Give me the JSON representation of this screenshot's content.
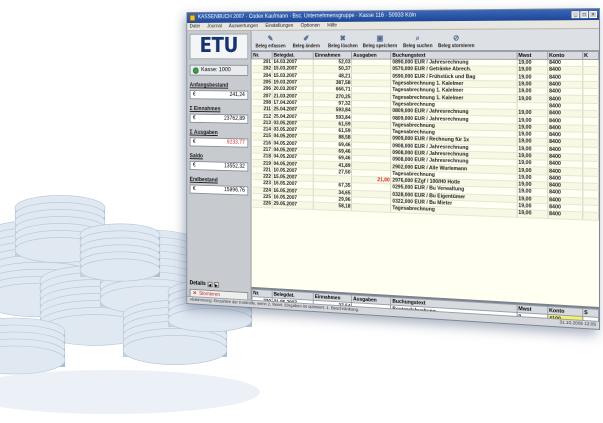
{
  "window": {
    "title": "KASSENBUCH 2007 · Codex Kaufmann · Bsc. Unternehmensgruppe · Kasse 116 · 50933 Köln",
    "menu": [
      "Datei",
      "Journal",
      "Auswertungen",
      "Einstellungen",
      "Optionen",
      "Hilfe"
    ]
  },
  "logo": "ETU",
  "sidebar": {
    "kasse": "Kasse: 1000",
    "anfangsbestand_label": "Anfangsbestand",
    "anfangsbestand_cur": "€",
    "anfangsbestand_value": "241,24",
    "einnahmen_label": "Σ Einnahmen",
    "einnahmen_cur": "€",
    "einnahmen_value": "23762,89",
    "ausgaben_label": "Σ Ausgaben",
    "ausgaben_cur": "€",
    "ausgaben_value": "9233,77",
    "saldo_label": "Saldo",
    "saldo_cur": "€",
    "saldo_value": "13552,32",
    "endbestand_label": "Endbestand",
    "endbestand_cur": "€",
    "endbestand_value": "15896,76",
    "details_label": "Details",
    "storno_label": "Stornieren"
  },
  "toolbar": [
    {
      "label": "Beleg erfassen",
      "icon": "pencil-icon"
    },
    {
      "label": "Beleg ändern",
      "icon": "edit-icon"
    },
    {
      "label": "Beleg löschen",
      "icon": "delete-icon"
    },
    {
      "label": "Beleg speichern",
      "icon": "save-icon"
    },
    {
      "label": "Beleg suchen",
      "icon": "search-icon"
    },
    {
      "label": "Beleg stornieren",
      "icon": "cancel-icon"
    }
  ],
  "columns": [
    "Nr.",
    "Belegdat.",
    "Einnahmen",
    "Ausgaben",
    "Buchungstext",
    "Mwst",
    "Konto",
    "K"
  ],
  "rows": [
    [
      "201",
      "14.03.2007",
      "52,03",
      "",
      "0890,000 EUR / Jahresrechnung",
      "19,00",
      "8400",
      ""
    ],
    [
      "202",
      "15.03.2007",
      "50,37",
      "",
      "0570,000 EUR / Getränke Abrech.",
      "19,00",
      "8400",
      ""
    ],
    [
      "204",
      "15.03.2007",
      "48,21",
      "",
      "0590,000 EUR / Frühstück und Bag",
      "19,00",
      "8400",
      ""
    ],
    [
      "205",
      "19.03.2007",
      "387,58",
      "",
      "Tagesabrechnung 1. Kalelmer",
      "19,00",
      "8400",
      ""
    ],
    [
      "206",
      "20.03.2007",
      "666,71",
      "",
      "Tagesabrechnung 1. Kalelmer",
      "19,00",
      "8400",
      ""
    ],
    [
      "207",
      "21.03.2007",
      "270,25",
      "",
      "Tagesabrechnung 1. Kalelmer",
      "19,00",
      "8400",
      ""
    ],
    [
      "208",
      "17.04.2007",
      "97,32",
      "",
      "Tagesabrechnung",
      "",
      "8400",
      ""
    ],
    [
      "211",
      "25.04.2007",
      "593,84",
      "",
      "0809,000 EUR / Jahresrechnung",
      "19,00",
      "8400",
      ""
    ],
    [
      "212",
      "25.04.2007",
      "593,84",
      "",
      "0809,000 EUR / Jahresrechnung",
      "19,00",
      "8400",
      ""
    ],
    [
      "213",
      "03.05.2007",
      "61,59",
      "",
      "Tagesabrechnung",
      "19,00",
      "8400",
      ""
    ],
    [
      "214",
      "03.05.2007",
      "61,59",
      "",
      "Tagesabrechnung",
      "19,00",
      "8400",
      ""
    ],
    [
      "215",
      "04.05.2007",
      "88,58",
      "",
      "0909,000 EUR / Rechnung für 1x",
      "19,00",
      "8400",
      ""
    ],
    [
      "216",
      "04.05.2007",
      "69,46",
      "",
      "0908,000 EUR / Jahresrechnung",
      "19,00",
      "8400",
      ""
    ],
    [
      "217",
      "04.05.2007",
      "69,46",
      "",
      "0908,000 EUR / Jahresrechnung",
      "19,00",
      "8400",
      ""
    ],
    [
      "218",
      "04.05.2007",
      "69,46",
      "",
      "0908,000 EUR / Jahresrechnung",
      "19,00",
      "8400",
      ""
    ],
    [
      "219",
      "04.05.2007",
      "41,89",
      "",
      "2902,000 EUR / Alle Wurlemann",
      "19,00",
      "8400",
      ""
    ],
    [
      "221",
      "10.05.2007",
      "27,50",
      "",
      "Tagesabrechnung",
      "19,00",
      "8400",
      ""
    ],
    [
      "222",
      "15.05.2007",
      "",
      "21,00",
      "2976,000 EZgf / 100/H0 Hotle",
      "19,00",
      "8400",
      ""
    ],
    [
      "223",
      "16.05.2007",
      "67,35",
      "",
      "0295,000 EUR / Bu Verwaltung",
      "19,00",
      "8400",
      ""
    ],
    [
      "224",
      "16.05.2007",
      "34,65",
      "",
      "0328,000 EUR / Bu Eigentümer",
      "19,00",
      "8400",
      ""
    ],
    [
      "225",
      "16.05.2007",
      "29,96",
      "",
      "0322,000 EUR / Bu Mieter",
      "19,00",
      "8400",
      ""
    ],
    [
      "226",
      "29.05.2007",
      "58,18",
      "",
      "Tagesabrechnung",
      "19,00",
      "8400",
      ""
    ]
  ],
  "entry": {
    "columns": [
      "Nr.",
      "Belegdat.",
      "Einnahmen",
      "Ausgaben",
      "Buchungstext",
      "Mwst",
      "Konto",
      "S"
    ],
    "values": [
      "230",
      "31.05.2007",
      "27,54",
      "",
      "Bestandsbuchung",
      "0",
      "4100",
      ""
    ]
  },
  "status": {
    "left": "Abstimmung: Einzahlen der Kontrolle, wenn 2. fixiert. Eingaben ist optimiert. 1. Beschränkung.",
    "right": "31.10.2005   12:05"
  }
}
